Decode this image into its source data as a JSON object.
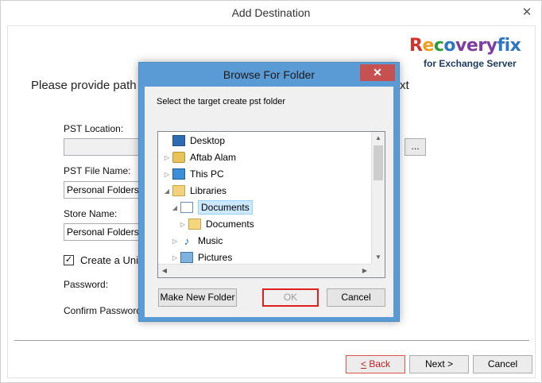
{
  "main": {
    "title": "Add Destination",
    "close_glyph": "✕",
    "instruction_head": "Please provide path",
    "instruction_tail": "xt",
    "logo": {
      "word_r": "R",
      "word_e": "e",
      "word_c": "c",
      "word_o": "o",
      "word_v": "very",
      "word_fix": "fix",
      "subtitle": "for Exchange Server"
    },
    "pst_location_label": "PST Location:",
    "pst_location_value": "",
    "browse_label": "...",
    "pst_file_name_label": "PST File Name:",
    "pst_file_name_value": "Personal Folders.pst",
    "store_name_label": "Store Name:",
    "store_name_value": "Personal Folders",
    "create_unicode_label": "Create a Unic",
    "create_unicode_checked": true,
    "checkbox_glyph": "✓",
    "password_label": "Password:",
    "confirm_password_label": "Confirm Password:",
    "back_label": "< Back",
    "next_label": "Next >",
    "cancel_label": "Cancel"
  },
  "dialog": {
    "title": "Browse For Folder",
    "close_glyph": "✕",
    "prompt": "Select the target create pst folder",
    "tree": [
      {
        "label": "Desktop",
        "icon": "desktop-icon",
        "arrow": ""
      },
      {
        "label": "Aftab  Alam",
        "icon": "user-folder-icon",
        "arrow": "▷"
      },
      {
        "label": "This PC",
        "icon": "computer-icon",
        "arrow": "▷"
      },
      {
        "label": "Libraries",
        "icon": "libraries-icon",
        "arrow": "◢"
      },
      {
        "label": "Documents",
        "icon": "documents-library-icon",
        "arrow": "◢"
      },
      {
        "label": "Documents",
        "icon": "folder-icon",
        "arrow": "▷"
      },
      {
        "label": "Music",
        "icon": "music-icon",
        "arrow": "▷"
      },
      {
        "label": "Pictures",
        "icon": "pictures-icon",
        "arrow": "▷"
      }
    ],
    "selected_item": "Documents",
    "scroll_up": "▲",
    "scroll_down": "▼",
    "scroll_left": "◀",
    "scroll_right": "▶",
    "make_new_folder_label": "Make New Folder",
    "ok_label": "OK",
    "cancel_label": "Cancel"
  },
  "colors": {
    "dialog_frame": "#5b9bd5",
    "close_button": "#c75050",
    "ok_highlight": "#e0201c",
    "selection": "#cce8ff"
  }
}
